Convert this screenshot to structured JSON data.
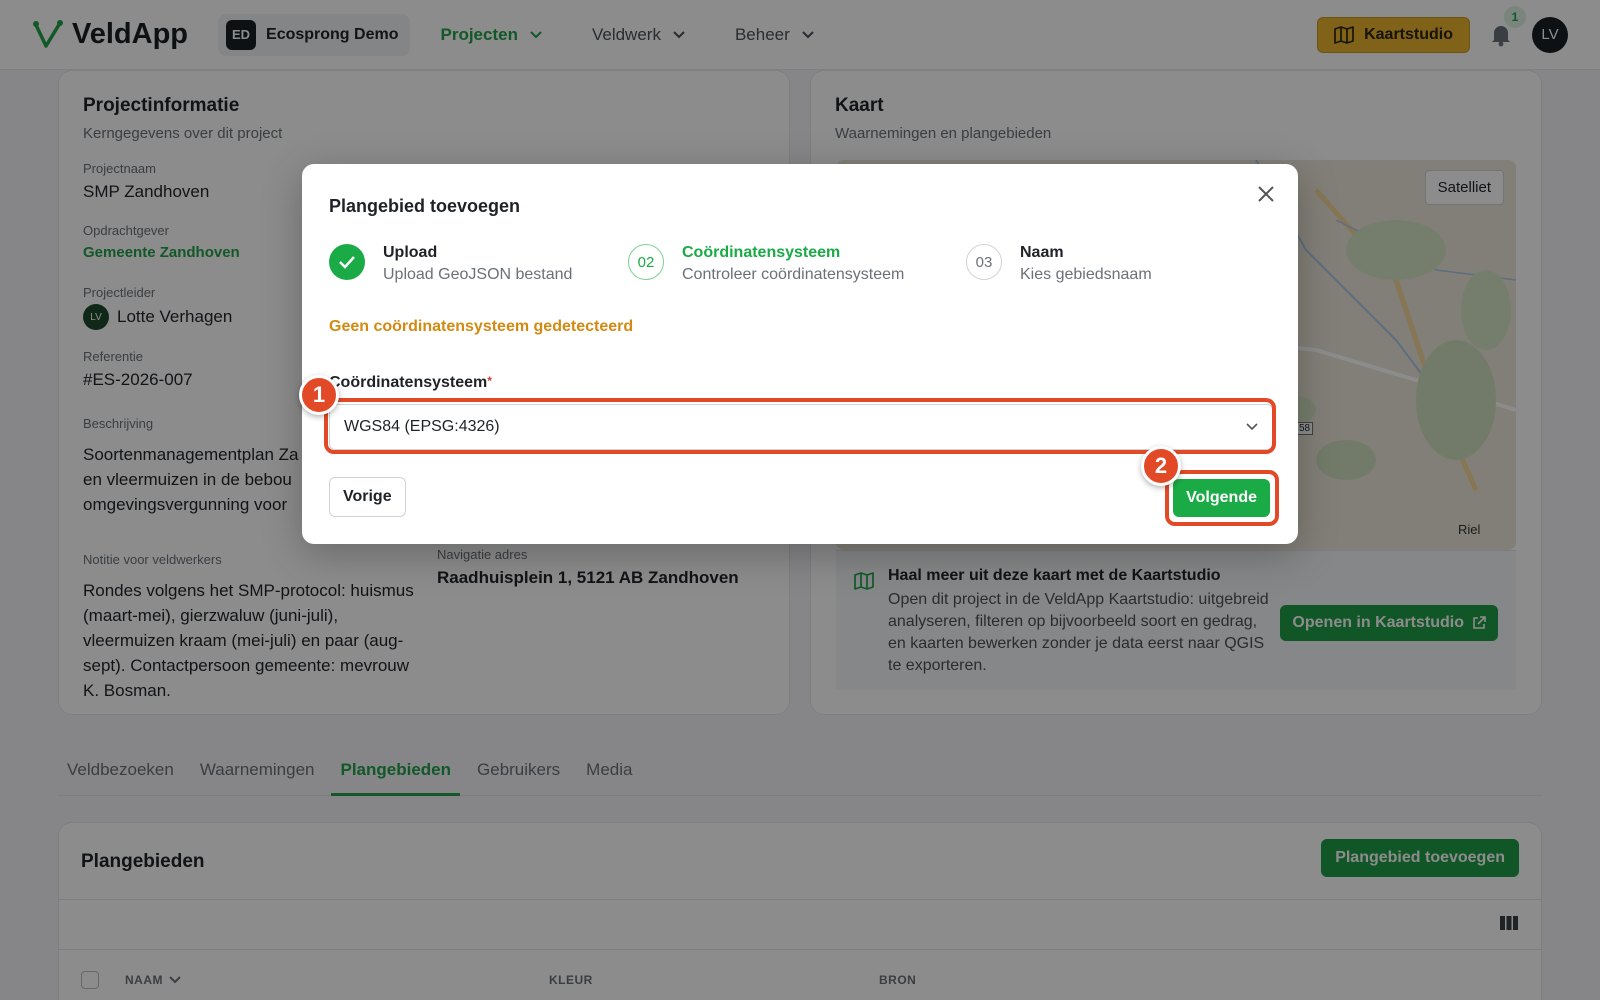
{
  "header": {
    "app_name": "VeldApp",
    "workspace_badge": "ED",
    "workspace_name": "Ecosprong Demo",
    "nav": [
      {
        "label": "Projecten"
      },
      {
        "label": "Veldwerk"
      },
      {
        "label": "Beheer"
      }
    ],
    "studio_button": "Kaartstudio",
    "notification_count": "1",
    "avatar": "LV"
  },
  "project_info": {
    "title": "Projectinformatie",
    "subtitle": "Kerngegevens over dit project",
    "name_label": "Projectnaam",
    "name_value": "SMP Zandhoven",
    "client_label": "Opdrachtgever",
    "client_value": "Gemeente Zandhoven",
    "lead_label": "Projectleider",
    "lead_avatar": "LV",
    "lead_value": "Lotte Verhagen",
    "ref_label": "Referentie",
    "ref_value": "#ES-2026-007",
    "desc_label": "Beschrijving",
    "desc_lines": [
      "Soortenmanagementplan Za",
      "en vleermuizen in de bebou",
      "omgevingsvergunning voor"
    ],
    "note_label": "Notitie voor veldwerkers",
    "note_value": "Rondes volgens het SMP-protocol: huismus (maart-mei), gierzwaluw (juni-juli), vleermuizen kraam (mei-juli) en paar (aug-sept). Contactpersoon gemeente: mevrouw K. Bosman.",
    "nav_label": "Navigatie adres",
    "nav_value": "Raadhuisplein 1, 5121 AB Zandhoven"
  },
  "map_card": {
    "title": "Kaart",
    "subtitle": "Waarnemingen en plangebieden",
    "satellite_button": "Satelliet",
    "map_label_riel": "Riel",
    "map_label_road": "58",
    "promo_title": "Haal meer uit deze kaart met de Kaartstudio",
    "promo_text": "Open dit project in de VeldApp Kaartstudio: uitgebreid analyseren, filteren op bijvoorbeeld soort en gedrag, en kaarten bewerken zonder je data eerst naar QGIS te exporteren.",
    "promo_button": "Openen in Kaartstudio"
  },
  "tabs": [
    {
      "label": "Veldbezoeken"
    },
    {
      "label": "Waarnemingen"
    },
    {
      "label": "Plangebieden"
    },
    {
      "label": "Gebruikers"
    },
    {
      "label": "Media"
    }
  ],
  "plangebieden": {
    "title": "Plangebieden",
    "add_button": "Plangebied toevoegen",
    "columns": [
      "NAAM",
      "KLEUR",
      "BRON"
    ]
  },
  "modal": {
    "title": "Plangebied toevoegen",
    "steps": [
      {
        "number": "",
        "title": "Upload",
        "sub": "Upload GeoJSON bestand",
        "state": "done"
      },
      {
        "number": "02",
        "title": "Coördinatensysteem",
        "sub": "Controleer coördinatensysteem",
        "state": "active"
      },
      {
        "number": "03",
        "title": "Naam",
        "sub": "Kies gebiedsnaam",
        "state": "todo"
      }
    ],
    "warning": "Geen coördinatensysteem gedetecteerd",
    "select_label": "Coördinatensysteem",
    "select_value": "WGS84 (EPSG:4326)",
    "prev_button": "Vorige",
    "next_button": "Volgende"
  },
  "annotations": {
    "marker_1": "1",
    "marker_2": "2"
  },
  "colors": {
    "brand_green": "#22a04b",
    "studio_yellow": "#e9b52e",
    "warning_orange": "#d48a12",
    "highlight_red": "#e24a27"
  }
}
